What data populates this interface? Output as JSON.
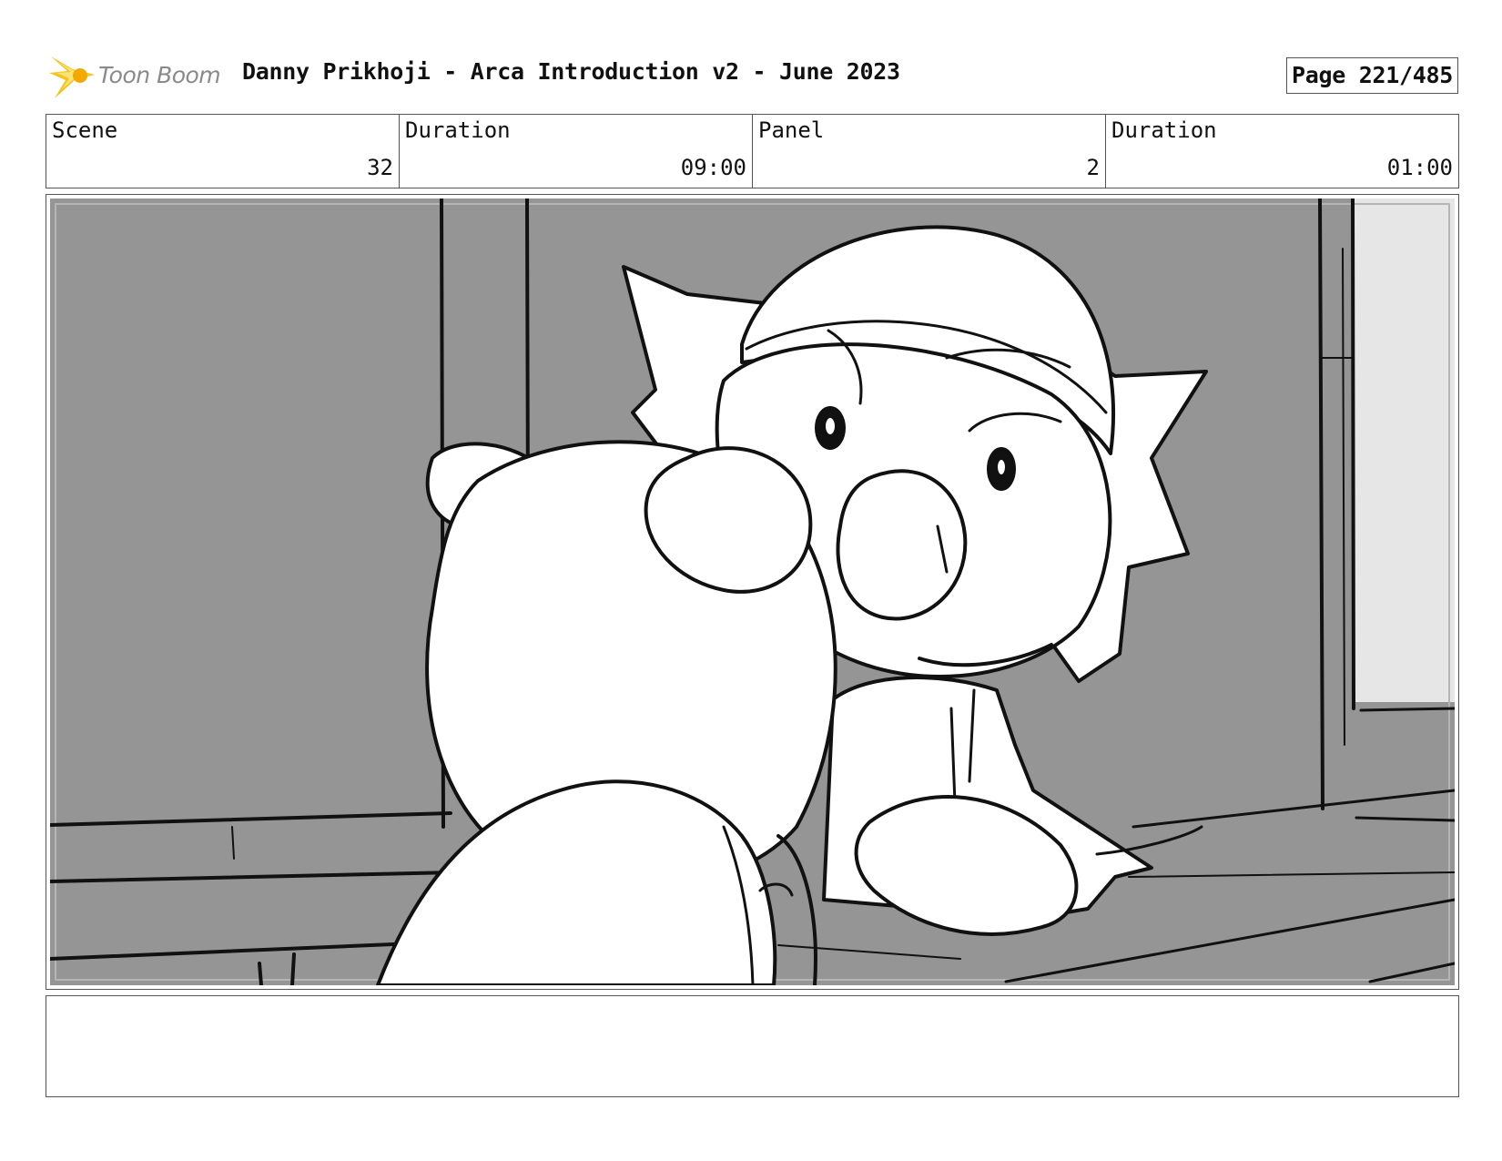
{
  "header": {
    "logo_text": "Toon Boom",
    "title": "Danny Prikhoji - Arca Introduction v2 - June 2023",
    "page_indicator": "Page 221/485"
  },
  "info": {
    "scene_label": "Scene",
    "scene_value": "32",
    "scene_duration_label": "Duration",
    "scene_duration_value": "09:00",
    "panel_label": "Panel",
    "panel_value": "2",
    "panel_duration_label": "Duration",
    "panel_duration_value": "01:00"
  },
  "colors": {
    "logo_star": "#f5c518",
    "panel_background": "#959595",
    "right_wall": "#e6e6e6",
    "sketch_line": "#111111"
  },
  "icons": {
    "logo": "toon-boom-star-icon"
  },
  "notes": ""
}
